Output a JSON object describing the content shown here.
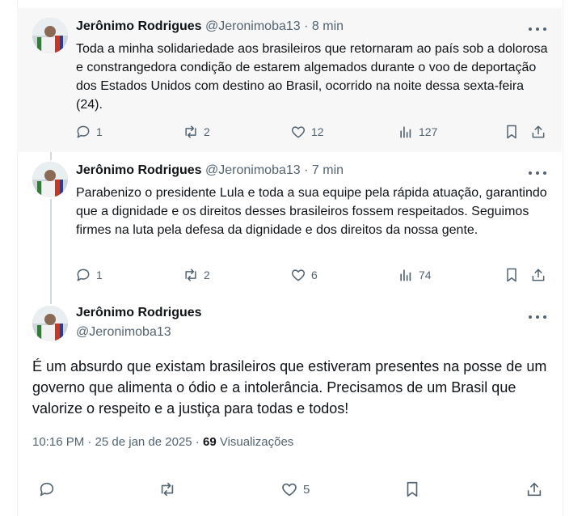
{
  "thread": [
    {
      "author_name": "Jerônimo Rodrigues",
      "handle": "@Jeronimoba13",
      "separator": "·",
      "time": "8 min",
      "text": "Toda a minha solidariedade aos brasileiros que retornaram ao país sob a dolorosa e constrangedora condição de estarem algemados durante o voo de deportação dos Estados Unidos com destino ao Brasil, ocorrido na noite dessa sexta-feira (24).",
      "replies": "1",
      "reposts": "2",
      "likes": "12",
      "views": "127"
    },
    {
      "author_name": "Jerônimo Rodrigues",
      "handle": "@Jeronimoba13",
      "separator": "·",
      "time": "7 min",
      "text": "Parabenizo o presidente Lula e toda a sua equipe pela rápida atuação, garantindo que a dignidade e os direitos desses brasileiros fossem respeitados. Seguimos firmes na luta pela defesa da dignidade e dos direitos da nossa gente.",
      "replies": "1",
      "reposts": "2",
      "likes": "6",
      "views": "74"
    }
  ],
  "main": {
    "author_name": "Jerônimo Rodrigues",
    "handle": "@Jeronimoba13",
    "text": "É um absurdo que existam brasileiros que estiveram presentes na posse de um governo que alimenta o ódio e a intolerância. Precisamos de um Brasil que valorize o respeito e a justiça para todas e todos!",
    "timestamp": "10:16 PM · 25 de jan de 2025 · ",
    "views_count": "69",
    "views_label": " Visualizações",
    "likes": "5"
  },
  "icons": [
    "reply-icon",
    "repost-icon",
    "like-icon",
    "views-icon",
    "bookmark-icon",
    "share-icon",
    "more-icon"
  ],
  "colors": {
    "text": "#0f1419",
    "secondary": "#536471",
    "thread_line": "#cfd9de",
    "highlight_bg": "#f7f7f7"
  }
}
